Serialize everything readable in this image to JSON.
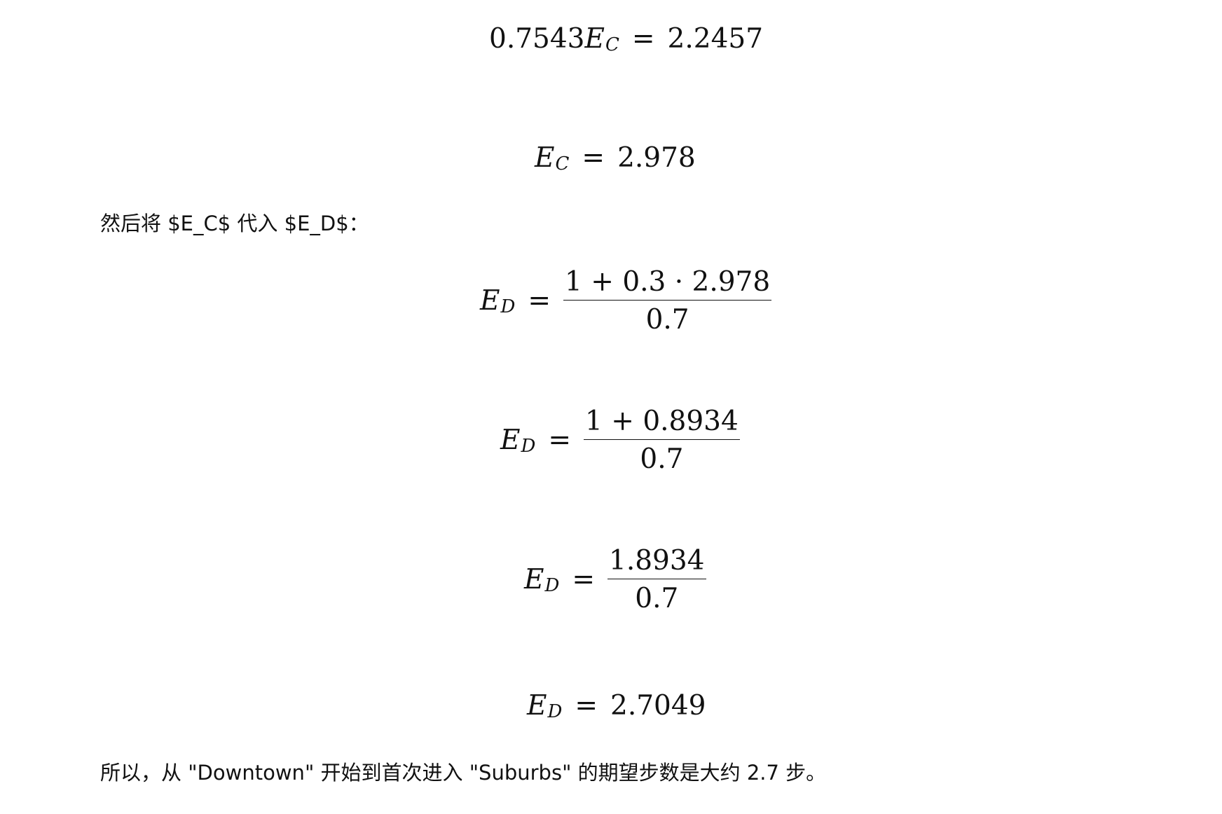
{
  "equations": {
    "eq1": {
      "lhs_coef": "0.7543",
      "var": "E",
      "sub": "C",
      "eq": "=",
      "rhs": "2.2457"
    },
    "eq2": {
      "var": "E",
      "sub": "C",
      "eq": "=",
      "rhs": "2.978"
    },
    "eq3": {
      "var": "E",
      "sub": "D",
      "eq": "=",
      "num": "1 + 0.3 · 2.978",
      "den": "0.7"
    },
    "eq4": {
      "var": "E",
      "sub": "D",
      "eq": "=",
      "num": "1 + 0.8934",
      "den": "0.7"
    },
    "eq5": {
      "var": "E",
      "sub": "D",
      "eq": "=",
      "num": "1.8934",
      "den": "0.7"
    },
    "eq6": {
      "var": "E",
      "sub": "D",
      "eq": "=",
      "rhs": "2.7049"
    }
  },
  "text": {
    "substitute_line": "然后将 $E_C$ 代入 $E_D$：",
    "conclusion_line": "所以，从 \"Downtown\" 开始到首次进入 \"Suburbs\" 的期望步数是大约 2.7 步。"
  }
}
